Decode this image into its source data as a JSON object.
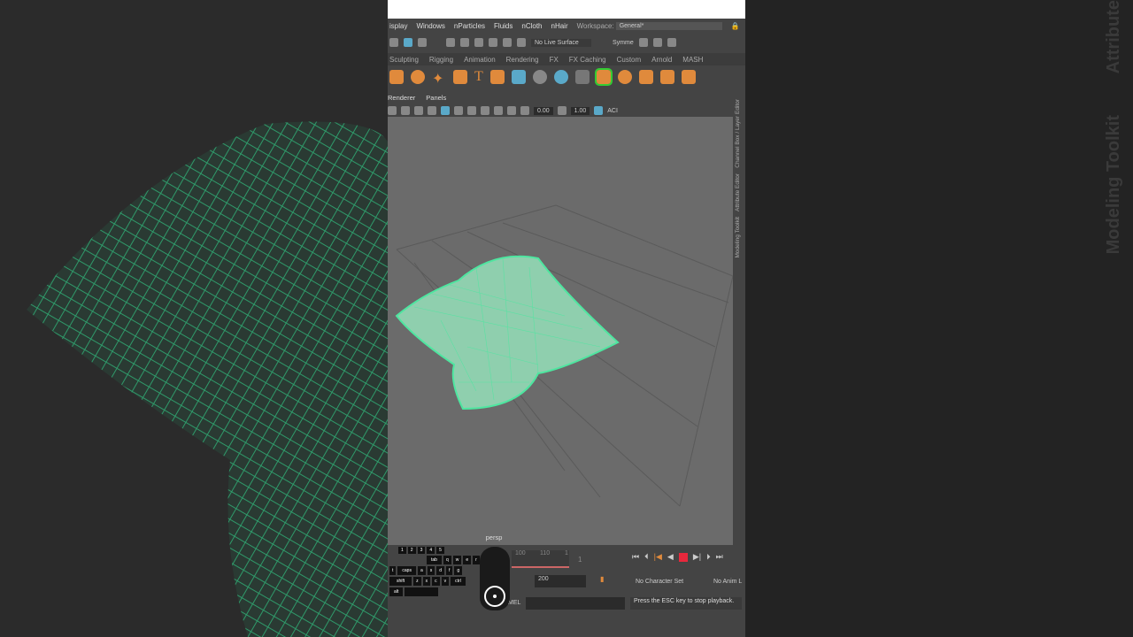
{
  "menu": [
    "isplay",
    "Windows",
    "nParticles",
    "Fluids",
    "nCloth",
    "nHair"
  ],
  "workspace": {
    "label": "Workspace:",
    "value": "General*"
  },
  "shelf": {
    "live_surface": "No Live Surface",
    "symmetry": "Symme"
  },
  "tabs": [
    "Sculpting",
    "Rigging",
    "Animation",
    "Rendering",
    "FX",
    "FX Caching",
    "Custom",
    "Arnold",
    "MASH"
  ],
  "viewport": {
    "menu": [
      "Renderer",
      "Panels"
    ],
    "val1": "0.00",
    "val2": "1.00",
    "aces": "ACI",
    "camera": "persp"
  },
  "side_tabs": [
    "Channel Box / Layer Editor",
    "Attribute Editor",
    "Modeling Toolkit"
  ],
  "timeline": {
    "ticks": [
      "100",
      "110",
      "1"
    ],
    "current": "1"
  },
  "range": {
    "end": "200",
    "charset": "No Character Set",
    "anim": "No Anim L"
  },
  "status": {
    "mel": "MEL",
    "help": "Press the ESC key to stop playback."
  },
  "keys": [
    "1",
    "2",
    "3",
    "4",
    "5",
    "tab",
    "q",
    "w",
    "e",
    "r",
    "t",
    "caps",
    "a",
    "s",
    "d",
    "f",
    "g",
    "shift",
    "z",
    "x",
    "c",
    "v",
    "ctrl",
    "alt"
  ],
  "bg_right": [
    "Attribute",
    "Modeling Toolkit"
  ],
  "colors": {
    "mesh": "#4ee6a0",
    "record": "#e8283c"
  }
}
